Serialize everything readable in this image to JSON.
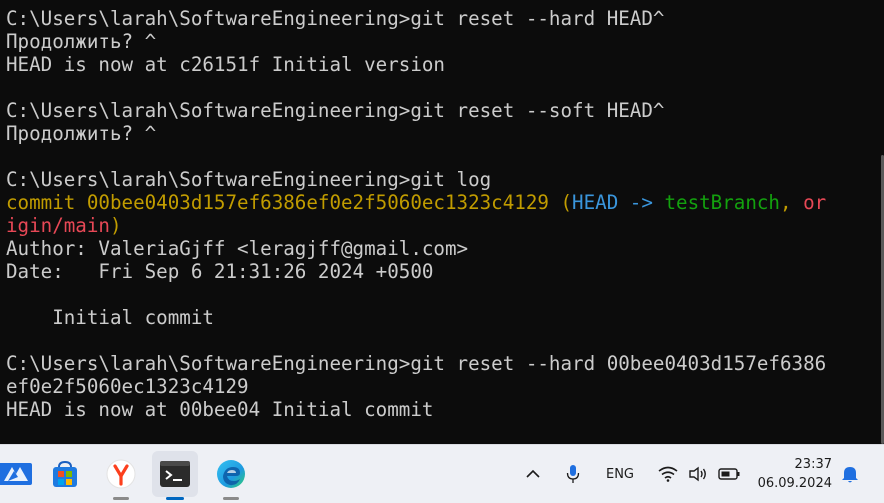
{
  "terminal": {
    "lines": [
      {
        "segments": [
          {
            "text": "C:\\Users\\larah\\SoftwareEngineering>git reset --hard HEAD^",
            "color": "#cccccc"
          }
        ]
      },
      {
        "segments": [
          {
            "text": "Продолжить? ^",
            "color": "#cccccc"
          }
        ]
      },
      {
        "segments": [
          {
            "text": "HEAD is now at c26151f Initial version",
            "color": "#cccccc"
          }
        ]
      },
      {
        "segments": [
          {
            "text": "",
            "color": "#cccccc"
          }
        ]
      },
      {
        "segments": [
          {
            "text": "C:\\Users\\larah\\SoftwareEngineering>git reset --soft HEAD^",
            "color": "#cccccc"
          }
        ]
      },
      {
        "segments": [
          {
            "text": "Продолжить? ^",
            "color": "#cccccc"
          }
        ]
      },
      {
        "segments": [
          {
            "text": "",
            "color": "#cccccc"
          }
        ]
      },
      {
        "segments": [
          {
            "text": "C:\\Users\\larah\\SoftwareEngineering>git log",
            "color": "#cccccc"
          }
        ]
      },
      {
        "segments": [
          {
            "text": "commit 00bee0403d157ef6386ef0e2f5060ec1323c4129 (",
            "color": "#c19c00"
          },
          {
            "text": "HEAD -> ",
            "color": "#3a96dd"
          },
          {
            "text": "testBranch",
            "color": "#13a10e"
          },
          {
            "text": ", ",
            "color": "#c19c00"
          },
          {
            "text": "or",
            "color": "#e74856"
          }
        ]
      },
      {
        "segments": [
          {
            "text": "igin/main",
            "color": "#e74856"
          },
          {
            "text": ")",
            "color": "#c19c00"
          }
        ]
      },
      {
        "segments": [
          {
            "text": "Author: ValeriaGjff <leragjff@gmail.com>",
            "color": "#cccccc"
          }
        ]
      },
      {
        "segments": [
          {
            "text": "Date:   Fri Sep 6 21:31:26 2024 +0500",
            "color": "#cccccc"
          }
        ]
      },
      {
        "segments": [
          {
            "text": "",
            "color": "#cccccc"
          }
        ]
      },
      {
        "segments": [
          {
            "text": "    Initial commit",
            "color": "#cccccc"
          }
        ]
      },
      {
        "segments": [
          {
            "text": "",
            "color": "#cccccc"
          }
        ]
      },
      {
        "segments": [
          {
            "text": "C:\\Users\\larah\\SoftwareEngineering>git reset --hard 00bee0403d157ef6386",
            "color": "#cccccc"
          }
        ]
      },
      {
        "segments": [
          {
            "text": "ef0e2f5060ec1323c4129",
            "color": "#cccccc"
          }
        ]
      },
      {
        "segments": [
          {
            "text": "HEAD is now at 00bee04 Initial commit",
            "color": "#cccccc"
          }
        ]
      }
    ]
  },
  "taskbar": {
    "apps": [
      {
        "name": "widgets-icon",
        "active": false
      },
      {
        "name": "store-icon",
        "active": false
      },
      {
        "name": "yandex-browser-icon",
        "active": false
      },
      {
        "name": "terminal-icon",
        "active": true
      },
      {
        "name": "edge-icon",
        "active": false
      }
    ],
    "tray": {
      "language": "ENG",
      "time": "23:37",
      "date": "06.09.2024"
    }
  },
  "colors": {
    "terminal_bg": "#0c0c0c",
    "terminal_text": "#cccccc",
    "git_yellow": "#c19c00",
    "git_cyan": "#3a96dd",
    "git_green": "#13a10e",
    "git_red": "#e74856",
    "taskbar_bg": "#eef0f5",
    "accent": "#0067c0"
  }
}
